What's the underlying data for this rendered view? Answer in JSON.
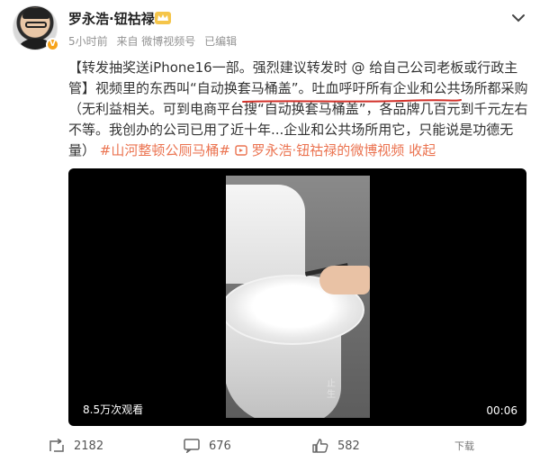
{
  "user": {
    "name": "罗永浩·钮祜禄",
    "verified_badge": "V",
    "meta": {
      "time": "5小时前",
      "source": "来自 微博视频号",
      "edited": "已编辑"
    }
  },
  "post": {
    "seg1": "【转发抽奖送iPhone16一部。强烈建议转发时 @ 给自己公司老板或行政主管】视频里的东西叫“自动换套马桶盖”。",
    "seg2_underlined": "吐血呼吁所有企业和公共场所都采购",
    "seg3": "（无利益相关。可到电商平台搜“自动换套马桶盖”，各品牌几百元到千元左右不等。我创办的公司已用了近十年...企业和公共场所用它，只能说是功德无量）",
    "hashtag": "#山河整顿公厕马桶#",
    "video_link_icon": "video-link-icon",
    "video_link": "罗永浩·钮祜禄的微博视频",
    "collapse": "收起"
  },
  "video": {
    "frame_caption": "止\n生",
    "views": "8.5万次观看",
    "duration": "00:06"
  },
  "footer": {
    "repost_count": "2182",
    "comment_count": "676",
    "like_count": "582",
    "more_label": "下载"
  },
  "colors": {
    "accent": "#eb7350",
    "underline": "#d2312a",
    "badge": "#f7a31a"
  }
}
